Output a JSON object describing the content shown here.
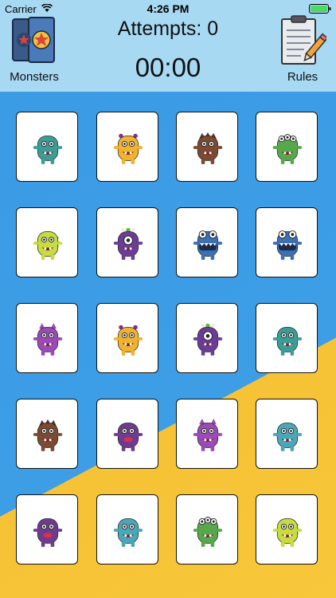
{
  "status_bar": {
    "carrier": "Carrier",
    "time": "4:26 PM"
  },
  "header": {
    "attempts_label": "Attempts: 0",
    "timer": "00:00",
    "monsters_label": "Monsters",
    "rules_label": "Rules"
  },
  "colors": {
    "header_bg": "#a7d9f3",
    "board_blue": "#3d9ee6",
    "board_yellow": "#f6c236",
    "card_bg": "#ffffff"
  },
  "cards": [
    {
      "monster": "teal-alien",
      "color": "#3b9e96"
    },
    {
      "monster": "yellow-striped",
      "color": "#f2b22c"
    },
    {
      "monster": "brown-hairy",
      "color": "#7a4a33"
    },
    {
      "monster": "green-three-eyed",
      "color": "#57a84c"
    },
    {
      "monster": "green-yellow-dino",
      "color": "#c7dc3f"
    },
    {
      "monster": "purple-cyclops",
      "color": "#6a3d97"
    },
    {
      "monster": "blue-big-mouth",
      "color": "#3d6fb3"
    },
    {
      "monster": "blue-big-mouth",
      "color": "#3d6fb3"
    },
    {
      "monster": "purple-cat",
      "color": "#9a4bb5"
    },
    {
      "monster": "yellow-striped",
      "color": "#f2b22c"
    },
    {
      "monster": "purple-cyclops",
      "color": "#6a3d97"
    },
    {
      "monster": "teal-alien",
      "color": "#3b9e96"
    },
    {
      "monster": "brown-hairy",
      "color": "#7a4a33"
    },
    {
      "monster": "purple-lips",
      "color": "#6e3b8f"
    },
    {
      "monster": "purple-cat",
      "color": "#9a4bb5"
    },
    {
      "monster": "teal-spotted",
      "color": "#4aa7b7"
    },
    {
      "monster": "purple-lips",
      "color": "#6e3b8f"
    },
    {
      "monster": "teal-spotted",
      "color": "#4aa7b7"
    },
    {
      "monster": "green-three-eyed",
      "color": "#57a84c"
    },
    {
      "monster": "green-yellow-dino",
      "color": "#c7dc3f"
    }
  ]
}
